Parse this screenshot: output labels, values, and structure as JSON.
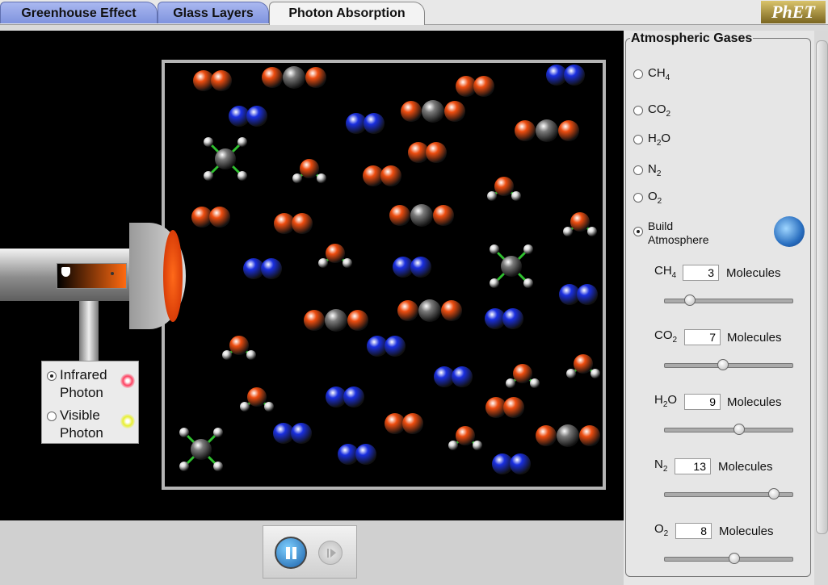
{
  "tabs": [
    {
      "label": "Greenhouse Effect"
    },
    {
      "label": "Glass Layers"
    },
    {
      "label": "Photon Absorption",
      "active": true
    }
  ],
  "logo": "PhET",
  "photon_options": [
    {
      "label_line1": "Infrared",
      "label_line2": "Photon",
      "selected": true
    },
    {
      "label_line1": "Visible",
      "label_line2": "Photon",
      "selected": false
    }
  ],
  "panel": {
    "title": "Atmospheric Gases",
    "gases": [
      {
        "formula": "CH",
        "sub": "4",
        "selected": false,
        "icon": "ch4-molecule-icon"
      },
      {
        "formula": "CO",
        "sub": "2",
        "selected": false,
        "icon": "co2-molecule-icon"
      },
      {
        "formula": "H",
        "sub": "2",
        "tail": "O",
        "selected": false,
        "icon": "h2o-molecule-icon"
      },
      {
        "formula": "N",
        "sub": "2",
        "selected": false,
        "icon": "n2-molecule-icon"
      },
      {
        "formula": "O",
        "sub": "2",
        "selected": false,
        "icon": "o2-molecule-icon"
      }
    ],
    "build_line1": "Build",
    "build_line2": "Atmosphere",
    "build_selected": true,
    "molecules_label": "Molecules",
    "counts": [
      {
        "formula": "CH",
        "sub": "4",
        "tail": "",
        "value": "3",
        "level": 0.2
      },
      {
        "formula": "CO",
        "sub": "2",
        "tail": "",
        "value": "7",
        "level": 0.46
      },
      {
        "formula": "H",
        "sub": "2",
        "tail": "O",
        "value": "9",
        "level": 0.59
      },
      {
        "formula": "N",
        "sub": "2",
        "tail": "",
        "value": "13",
        "level": 0.86
      },
      {
        "formula": "O",
        "sub": "2",
        "tail": "",
        "value": "8",
        "level": 0.55
      }
    ]
  },
  "colors": {
    "oxygen": "#ee4d10",
    "nitrogen": "#1a2fe0",
    "carbon": "#7a7a7a",
    "hydrogen": "#dddddd",
    "bond_green": "#2ec02e"
  }
}
